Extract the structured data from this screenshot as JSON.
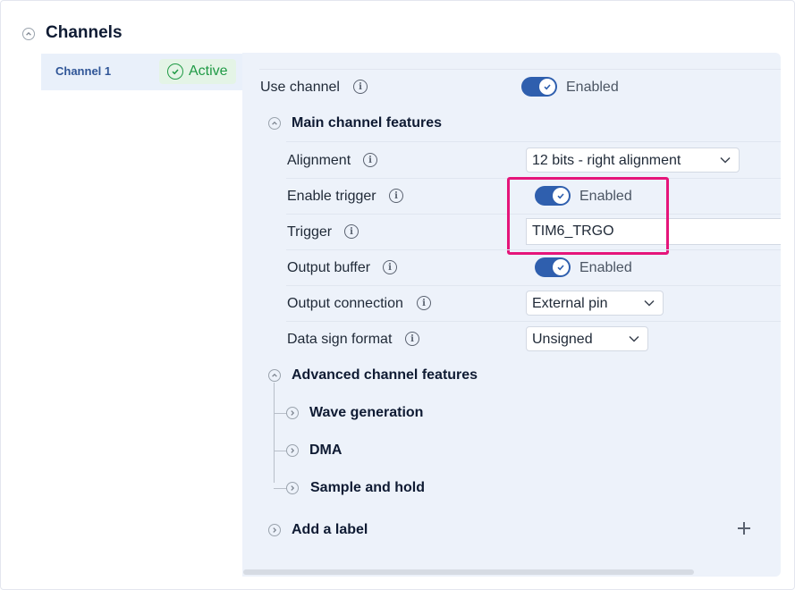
{
  "section": {
    "title": "Channels"
  },
  "tabs": [
    {
      "label": "Channel 1",
      "status": "Active"
    }
  ],
  "use_channel": {
    "label": "Use channel",
    "toggle_state": "Enabled"
  },
  "main_features": {
    "title": "Main channel features",
    "alignment": {
      "label": "Alignment",
      "value": "12 bits - right alignment"
    },
    "enable_trigger": {
      "label": "Enable trigger",
      "toggle_state": "Enabled"
    },
    "trigger": {
      "label": "Trigger",
      "value": "TIM6_TRGO"
    },
    "output_buffer": {
      "label": "Output buffer",
      "toggle_state": "Enabled"
    },
    "output_connection": {
      "label": "Output connection",
      "value": "External pin"
    },
    "data_sign_format": {
      "label": "Data sign format",
      "value": "Unsigned"
    }
  },
  "advanced_features": {
    "title": "Advanced channel features",
    "items": [
      {
        "label": "Wave generation"
      },
      {
        "label": "DMA"
      },
      {
        "label": "Sample and hold"
      }
    ]
  },
  "add_label": {
    "label": "Add a label"
  },
  "colors": {
    "accent": "#2f5fae",
    "active_green": "#1f9a45",
    "highlight": "#e5157a",
    "panel_bg": "#edf2fa"
  },
  "icons": {
    "collapse": "chevron-up-circle-icon",
    "expand": "chevron-right-circle-icon",
    "info": "info-icon",
    "check": "check-icon",
    "dropdown": "chevron-down-icon",
    "add": "plus-icon"
  }
}
